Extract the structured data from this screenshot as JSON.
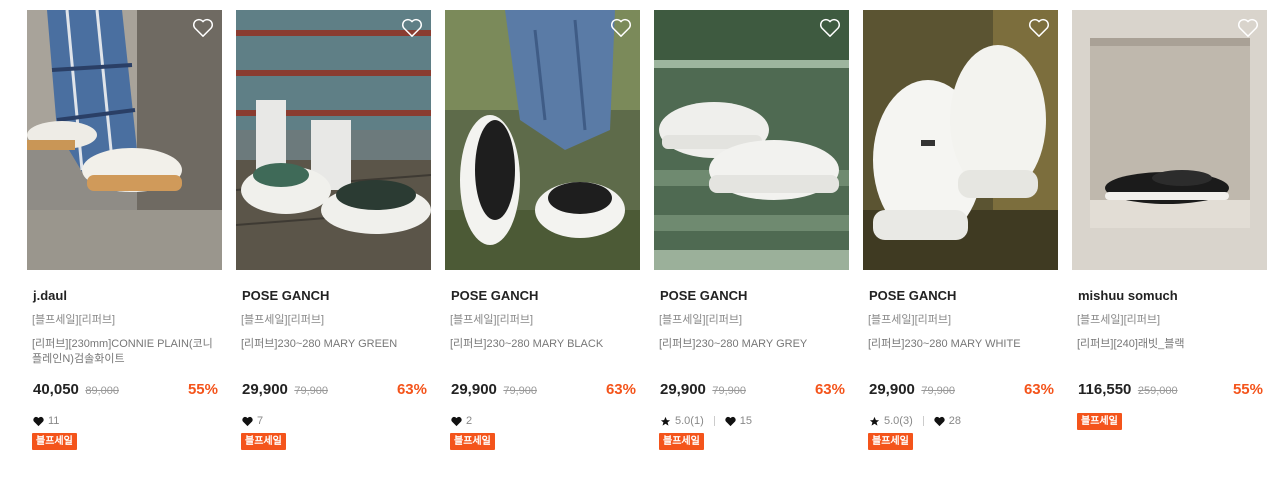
{
  "colors": {
    "accent": "#f4541b",
    "text": "#222222",
    "muted": "#888888"
  },
  "products": [
    {
      "brand": "j.daul",
      "tags": "[블프세일][리퍼브]",
      "name": "[리퍼브][230mm]CONNIE PLAIN(코니플레인N)검솔화이트",
      "price": "40,050",
      "original_price": "89,000",
      "discount": "55%",
      "rating": "",
      "likes": "11",
      "badge": "블프세일"
    },
    {
      "brand": "POSE GANCH",
      "tags": "[블프세일][리퍼브]",
      "name": "[리퍼브]230~280 MARY GREEN",
      "price": "29,900",
      "original_price": "79,900",
      "discount": "63%",
      "rating": "",
      "likes": "7",
      "badge": "블프세일"
    },
    {
      "brand": "POSE GANCH",
      "tags": "[블프세일][리퍼브]",
      "name": "[리퍼브]230~280 MARY BLACK",
      "price": "29,900",
      "original_price": "79,900",
      "discount": "63%",
      "rating": "",
      "likes": "2",
      "badge": "블프세일"
    },
    {
      "brand": "POSE GANCH",
      "tags": "[블프세일][리퍼브]",
      "name": "[리퍼브]230~280 MARY GREY",
      "price": "29,900",
      "original_price": "79,900",
      "discount": "63%",
      "rating": "5.0(1)",
      "likes": "15",
      "badge": "블프세일"
    },
    {
      "brand": "POSE GANCH",
      "tags": "[블프세일][리퍼브]",
      "name": "[리퍼브]230~280 MARY WHITE",
      "price": "29,900",
      "original_price": "79,900",
      "discount": "63%",
      "rating": "5.0(3)",
      "likes": "28",
      "badge": "블프세일"
    },
    {
      "brand": "mishuu somuch",
      "tags": "[블프세일][리퍼브]",
      "name": "[리퍼브][240]래빗_블랙",
      "price": "116,550",
      "original_price": "259,000",
      "discount": "55%",
      "rating": "",
      "likes": "",
      "badge": "블프세일"
    }
  ]
}
